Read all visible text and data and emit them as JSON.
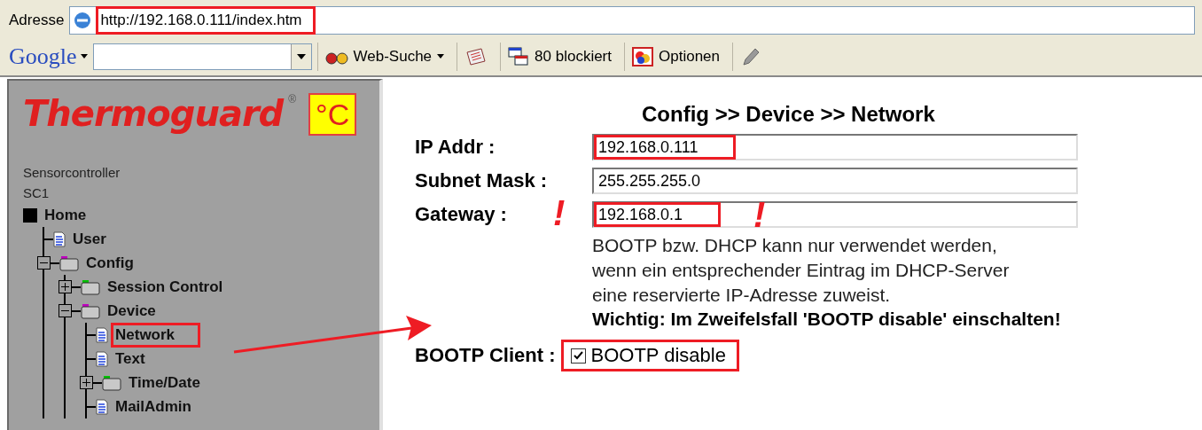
{
  "address_bar": {
    "label": "Adresse",
    "url": "http://192.168.0.111/index.htm",
    "highlighted": true
  },
  "google_toolbar": {
    "logo": "Google",
    "buttons": [
      {
        "kind": "search",
        "label": "Web-Suche"
      },
      {
        "kind": "news"
      },
      {
        "kind": "popup",
        "label": "80 blockiert"
      },
      {
        "kind": "options",
        "label": "Optionen"
      },
      {
        "kind": "pencil"
      }
    ]
  },
  "sidebar": {
    "logo": "Thermoguard",
    "logo_mark": "®",
    "logo_unit": "°C",
    "device_type": "Sensorcontroller",
    "device_name": "SC1",
    "tree": [
      {
        "label": "Home",
        "kind": "root",
        "highlighted": false,
        "children": [
          {
            "label": "User",
            "kind": "page",
            "highlighted": false
          },
          {
            "label": "Config",
            "kind": "folder",
            "color": "#c000c0",
            "expanded": true,
            "highlighted": false,
            "children": [
              {
                "label": "Session Control",
                "kind": "folder",
                "color": "#00c000",
                "expanded": false,
                "highlighted": false
              },
              {
                "label": "Device",
                "kind": "folder",
                "color": "#c000c0",
                "expanded": true,
                "highlighted": false,
                "children": [
                  {
                    "label": "Network",
                    "kind": "page",
                    "highlighted": true
                  },
                  {
                    "label": "Text",
                    "kind": "page",
                    "highlighted": false
                  },
                  {
                    "label": "Time/Date",
                    "kind": "folder",
                    "color": "#00c000",
                    "expanded": false,
                    "highlighted": false
                  },
                  {
                    "label": "MailAdmin",
                    "kind": "page",
                    "highlighted": false
                  }
                ]
              }
            ]
          }
        ]
      }
    ]
  },
  "content": {
    "breadcrumb": "Config >> Device >> Network",
    "fields": [
      {
        "label": "IP Addr :",
        "value": "192.168.0.111",
        "highlighted": true
      },
      {
        "label": "Subnet Mask :",
        "value": "255.255.255.0",
        "highlighted": false
      },
      {
        "label": "Gateway :",
        "value": "192.168.0.1",
        "highlighted": true,
        "warning_mark": "!"
      }
    ],
    "note": [
      "BOOTP bzw. DHCP kann nur verwendet werden,",
      "wenn ein entsprechender Eintrag im DHCP-Server",
      "eine reservierte IP-Adresse zuweist."
    ],
    "note_important": "Wichtig: Im Zweifelsfall 'BOOTP disable' einschalten!",
    "bootp": {
      "label": "BOOTP Client :",
      "option": "BOOTP disable",
      "checked": true,
      "highlighted": true
    }
  }
}
